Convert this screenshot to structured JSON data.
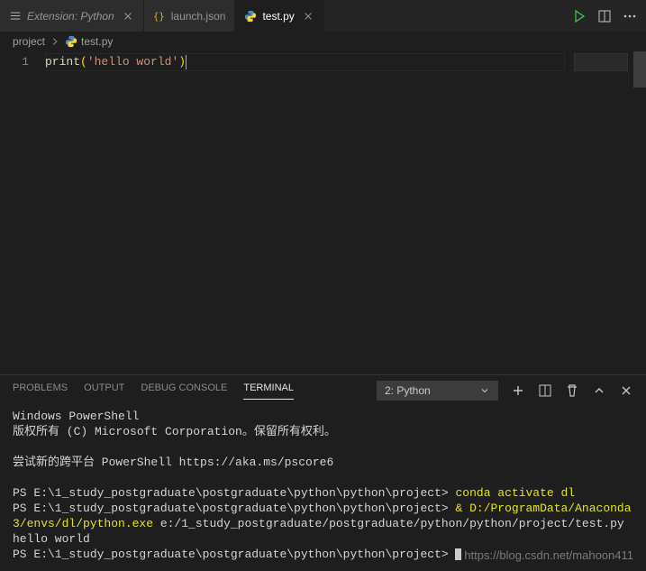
{
  "tabs": [
    {
      "label": "Extension: Python",
      "icon": "fold",
      "italic": true,
      "active": false,
      "close": true
    },
    {
      "label": "launch.json",
      "icon": "json",
      "italic": false,
      "active": false,
      "close": false
    },
    {
      "label": "test.py",
      "icon": "python",
      "italic": false,
      "active": true,
      "close": true
    }
  ],
  "breadcrumb": {
    "folder": "project",
    "file": "test.py"
  },
  "editor": {
    "line_number": "1",
    "code": {
      "fn": "print",
      "lparen": "(",
      "str": "'hello world'",
      "rparen": ")"
    }
  },
  "panel": {
    "tabs": {
      "problems": "PROBLEMS",
      "output": "OUTPUT",
      "debug": "DEBUG CONSOLE",
      "terminal": "TERMINAL"
    },
    "term_dropdown": "2: Python"
  },
  "terminal": {
    "line1": "Windows PowerShell",
    "line2": "版权所有 (C) Microsoft Corporation。保留所有权利。",
    "line3": "尝试新的跨平台 PowerShell https://aka.ms/pscore6",
    "prompt1_pre": "PS E:\\1_study_postgraduate\\postgraduate\\python\\python\\project> ",
    "prompt1_cmd": "conda activate dl",
    "prompt2_pre": "PS E:\\1_study_postgraduate\\postgraduate\\python\\python\\project> ",
    "prompt2_amp": "& ",
    "prompt2_exe": "D:/ProgramData/Anaconda3/envs/dl/python.exe",
    "prompt2_arg": " e:/1_study_postgraduate/postgraduate/python/python/project/test.py",
    "output": "hello world",
    "prompt3": "PS E:\\1_study_postgraduate\\postgraduate\\python\\python\\project> "
  },
  "watermark": "https://blog.csdn.net/mahoon411"
}
